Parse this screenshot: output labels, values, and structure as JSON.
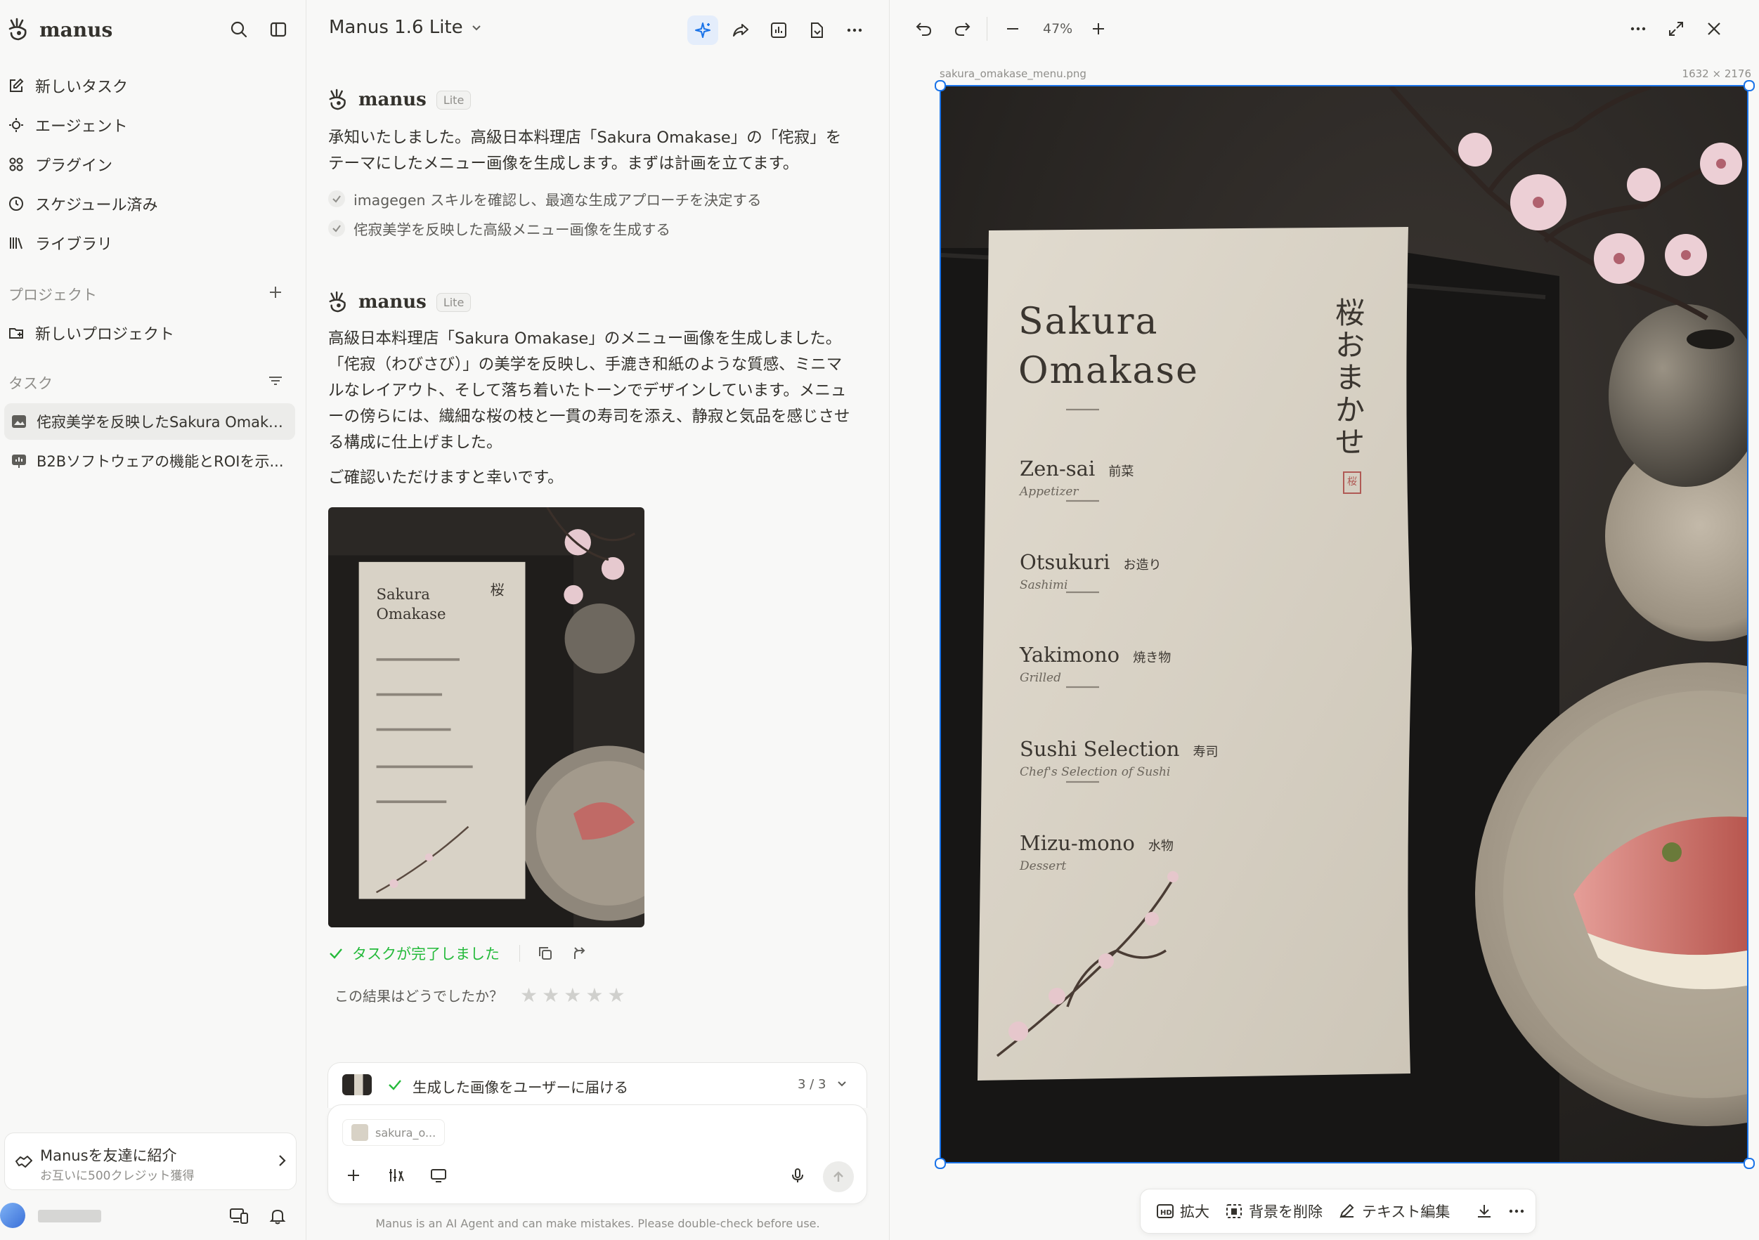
{
  "sidebar": {
    "logo_text": "manus",
    "nav": [
      {
        "label": "新しいタスク",
        "icon": "new-task-icon"
      },
      {
        "label": "エージェント",
        "icon": "agent-icon"
      },
      {
        "label": "プラグイン",
        "icon": "plugin-icon"
      },
      {
        "label": "スケジュール済み",
        "icon": "clock-icon"
      },
      {
        "label": "ライブラリ",
        "icon": "library-icon"
      }
    ],
    "projects_label": "プロジェクト",
    "new_project": "新しいプロジェクト",
    "tasks_label": "タスク",
    "tasks": [
      {
        "label": "侘寂美学を反映したSakura Omakas...",
        "active": true
      },
      {
        "label": "B2Bソフトウェアの機能とROIを示...",
        "active": false
      }
    ],
    "referral": {
      "title": "Manusを友達に紹介",
      "subtitle": "お互いに500クレジット獲得"
    }
  },
  "chat": {
    "model_title": "Manus 1.6 Lite",
    "messages": [
      {
        "sender": "manus",
        "badge": "Lite",
        "text": "承知いたしました。高級日本料理店「Sakura Omakase」の「侘寂」をテーマにしたメニュー画像を生成します。まずは計画を立てます。",
        "steps": [
          "imagegen スキルを確認し、最適な生成アプローチを決定する",
          "侘寂美学を反映した高級メニュー画像を生成する"
        ]
      },
      {
        "sender": "manus",
        "badge": "Lite",
        "text": "高級日本料理店「Sakura Omakase」のメニュー画像を生成しました。「侘寂（わびさび）」の美学を反映し、手漉き和紙のような質感、ミニマルなレイアウト、そして落ち着いたトーンでデザインしています。メニューの傍らには、繊細な桜の枝と一貫の寿司を添え、静寂と気品を感じさせる構成に仕上げました。",
        "text2": "ご確認いただけますと幸いです。"
      }
    ],
    "task_done": "タスクが完了しました",
    "rating_prompt": "この結果はどうでしたか？",
    "rating_stars": 5,
    "plan_step": "生成した画像をユーザーに届ける",
    "plan_progress": "3 / 3",
    "attachment_name": "sakura_o...",
    "disclaimer": "Manus is an AI Agent and can make mistakes. Please double-check before use."
  },
  "viewer": {
    "zoom": "47%",
    "file_name": "sakura_omakase_menu.png",
    "dimensions": "1632 × 2176",
    "actions": [
      {
        "label": "拡大",
        "icon": "hd-icon"
      },
      {
        "label": "背景を削除",
        "icon": "remove-bg-icon"
      },
      {
        "label": "テキスト編集",
        "icon": "pencil-icon"
      }
    ]
  },
  "menu_card": {
    "title_line1": "Sakura",
    "title_line2": "Omakase",
    "vertical_title": "桜おまかせ",
    "seal": "桜",
    "items": [
      {
        "name": "Zen-sai",
        "jp": "前菜",
        "sub": "Appetizer"
      },
      {
        "name": "Otsukuri",
        "jp": "お造り",
        "sub": "Sashimi"
      },
      {
        "name": "Yakimono",
        "jp": "焼き物",
        "sub": "Grilled"
      },
      {
        "name": "Sushi Selection",
        "jp": "寿司",
        "sub": "Chef's Selection of Sushi"
      },
      {
        "name": "Mizu-mono",
        "jp": "水物",
        "sub": "Dessert"
      }
    ]
  },
  "colors": {
    "accent_blue": "#1a73e8",
    "success_green": "#25ba3b",
    "sidebar_bg": "#f8f8f7"
  }
}
